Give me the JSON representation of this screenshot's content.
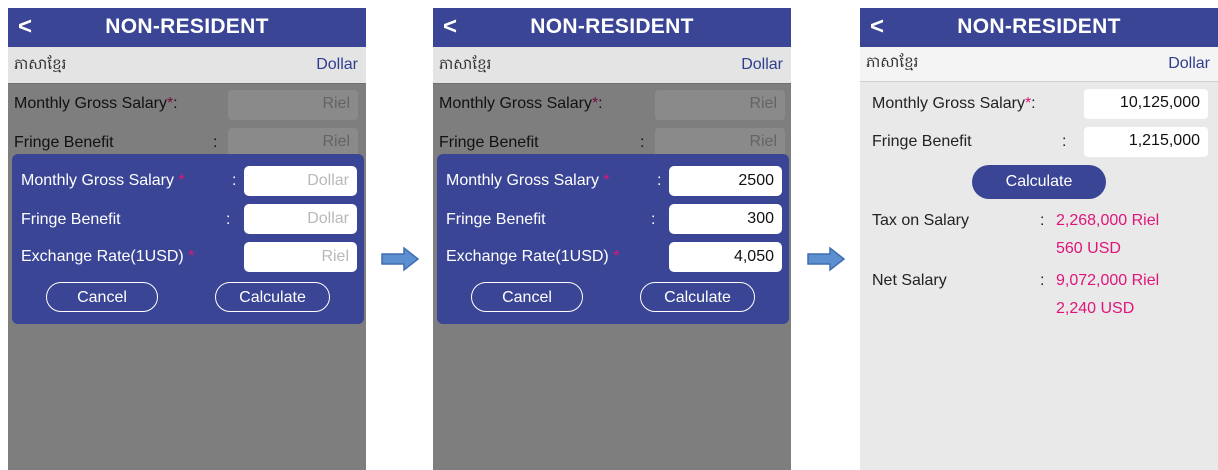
{
  "app": {
    "title": "NON-RESIDENT",
    "back_glyph": "<",
    "language_label": "ភាសាខ្មែរ",
    "currency_label": "Dollar",
    "colors": {
      "header": "#3a4595",
      "dialog": "#3a4595",
      "required_marker": "#e0157a",
      "result_text": "#e0157a",
      "arrow": "#5b8fd0"
    }
  },
  "background_form": {
    "salary_label": "Monthly Gross Salary",
    "fringe_label": "Fringe Benefit",
    "required_marker": "*",
    "colon": ":",
    "riel_placeholder": "Riel"
  },
  "dialog": {
    "salary_label": "Monthly Gross Salary ",
    "fringe_label": "Fringe Benefit",
    "rate_label": "Exchange Rate(1USD) ",
    "required_marker": "*",
    "colon": ":",
    "dollar_placeholder": "Dollar",
    "riel_placeholder": "Riel",
    "cancel_label": "Cancel",
    "calculate_label": "Calculate"
  },
  "filled_values": {
    "salary": "2500",
    "fringe": "300",
    "rate": "4,050"
  },
  "result_screen": {
    "salary_label": "Monthly Gross Salary",
    "fringe_label": "Fringe Benefit",
    "salary_value": "10,125,000",
    "fringe_value": "1,215,000",
    "calculate_label": "Calculate",
    "tax_label": "Tax on Salary",
    "tax_riel": "2,268,000 Riel",
    "tax_usd": "560 USD",
    "net_label": "Net Salary",
    "net_riel": "9,072,000 Riel",
    "net_usd": "2,240 USD"
  },
  "icons": {
    "back": "back-arrow-icon",
    "flow_arrow": "right-arrow-icon"
  }
}
